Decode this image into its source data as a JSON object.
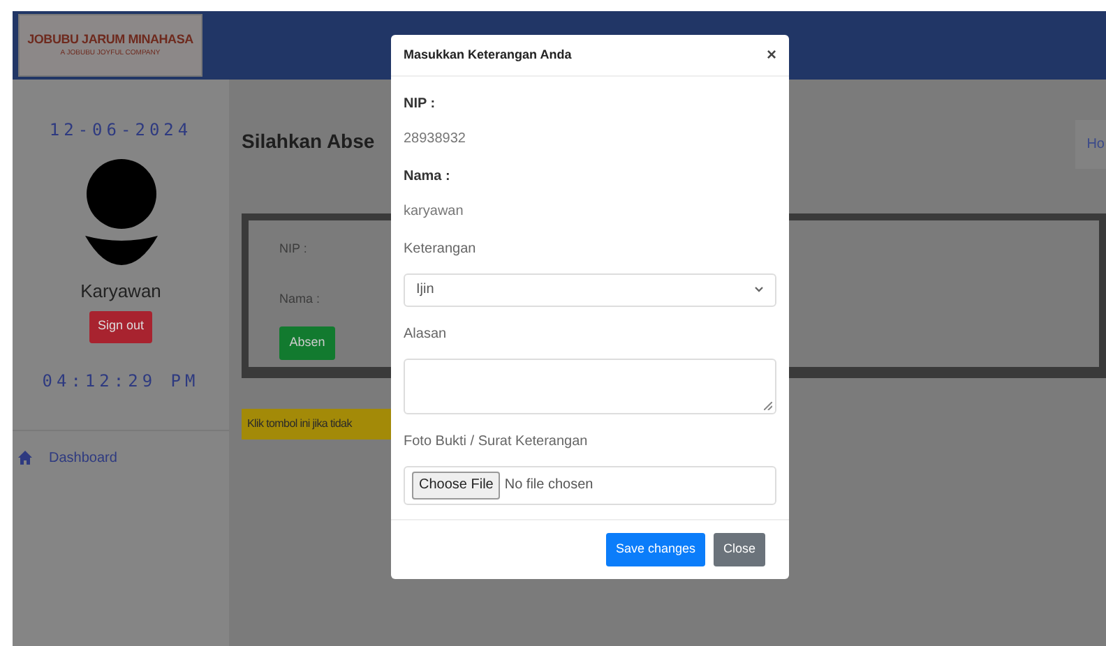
{
  "header": {
    "logo_title": "JOBUBU JARUM MINAHASA",
    "logo_tagline": "A JOBUBU JOYFUL COMPANY"
  },
  "sidebar": {
    "date": "12-06-2024",
    "user_name": "Karyawan",
    "sign_out": "Sign out",
    "time": "04:12:29 PM",
    "nav_items": [
      {
        "label": "Dashboard"
      }
    ]
  },
  "main": {
    "title": "Silahkan Abse",
    "breadcrumb": "Ho",
    "card_fields": [
      "NIP :",
      "Nama :"
    ],
    "card_button": "Absen",
    "notice": "Klik tombol ini jika tidak"
  },
  "modal": {
    "title": "Masukkan Keterangan Anda",
    "close": "×",
    "fields": [
      {
        "kind": "static",
        "label": "NIP :",
        "value": "28938932"
      },
      {
        "kind": "static",
        "label": "Nama :",
        "value": "karyawan"
      },
      {
        "kind": "select",
        "label": "Keterangan",
        "value": "Ijin"
      },
      {
        "kind": "textarea",
        "label": "Alasan"
      },
      {
        "kind": "file",
        "label": "Foto Bukti / Surat Keterangan",
        "button": "Choose File",
        "status": "No file chosen"
      }
    ],
    "buttons": [
      {
        "kind": "primary",
        "label": "Save changes"
      },
      {
        "kind": "secondary",
        "label": "Close"
      }
    ]
  }
}
